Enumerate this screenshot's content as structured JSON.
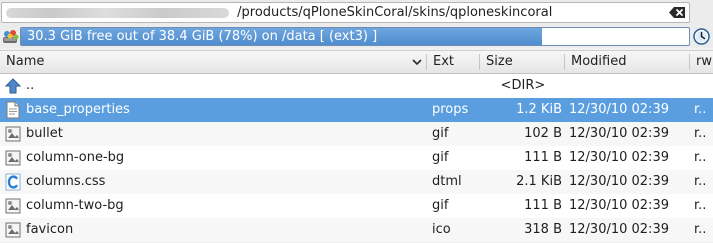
{
  "path": {
    "text": "/products/qPloneSkinCoral/skins/qploneskincoral"
  },
  "free_space": {
    "text": "30.3 GiB free out of 38.4 GiB (78%) on /data [ (ext3) ]",
    "fraction_used": 0.78
  },
  "columns": {
    "name": "Name",
    "ext": "Ext",
    "size": "Size",
    "modified": "Modified",
    "rwx": "rw"
  },
  "rows": [
    {
      "name": "..",
      "ext": "",
      "size": "<DIR>",
      "modified": "",
      "rwx": "",
      "icon": "folder-up-icon"
    },
    {
      "name": "base_properties",
      "ext": "props",
      "size": "1.2 KiB",
      "modified": "12/30/10 02:39",
      "rwx": "r..",
      "icon": "text-file-icon"
    },
    {
      "name": "bullet",
      "ext": "gif",
      "size": "102 B",
      "modified": "12/30/10 02:39",
      "rwx": "r..",
      "icon": "image-file-icon"
    },
    {
      "name": "column-one-bg",
      "ext": "gif",
      "size": "111 B",
      "modified": "12/30/10 02:39",
      "rwx": "r..",
      "icon": "image-file-icon"
    },
    {
      "name": "columns.css",
      "ext": "dtml",
      "size": "2.1 KiB",
      "modified": "12/30/10 02:39",
      "rwx": "r..",
      "icon": "css-file-icon"
    },
    {
      "name": "column-two-bg",
      "ext": "gif",
      "size": "111 B",
      "modified": "12/30/10 02:39",
      "rwx": "r..",
      "icon": "image-file-icon"
    },
    {
      "name": "favicon",
      "ext": "ico",
      "size": "318 B",
      "modified": "12/30/10 02:39",
      "rwx": "r..",
      "icon": "image-file-icon"
    }
  ],
  "colors": {
    "selection": "#5a9ee0",
    "progress": "#4f8dcf"
  }
}
